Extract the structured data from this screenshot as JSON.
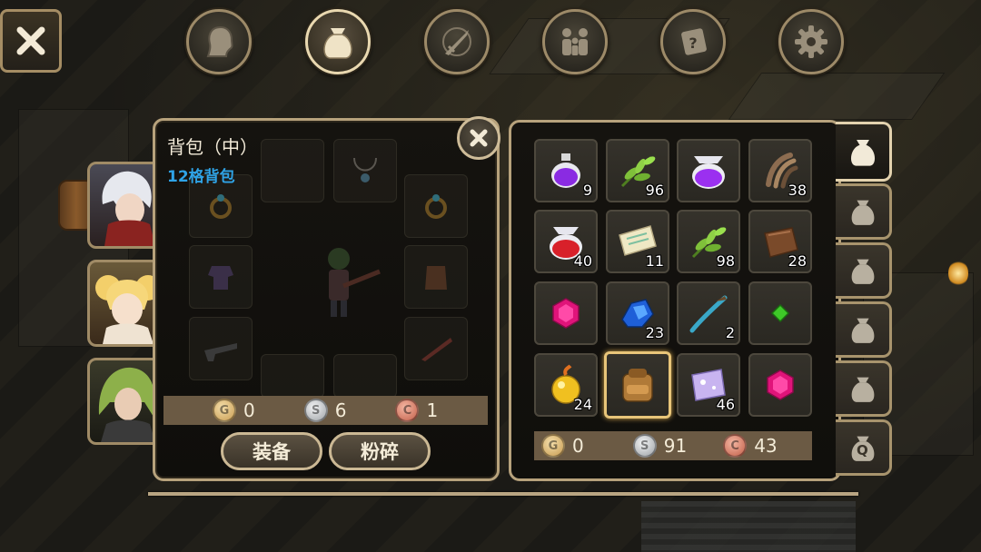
{
  "bag_panel": {
    "title": "背包（中）",
    "subtitle": "12格背包",
    "subtitle_color": "#2fa3e6",
    "currency": {
      "gold": "0",
      "silver": "6",
      "copper": "1"
    },
    "buttons": {
      "equip": "装备",
      "smash": "粉碎"
    }
  },
  "inventory": {
    "currency": {
      "gold": "0",
      "silver": "91",
      "copper": "43"
    },
    "items": [
      {
        "icon": "purple-potion-icon",
        "count": "9"
      },
      {
        "icon": "green-herb-icon",
        "count": "96"
      },
      {
        "icon": "purple-potion-large-icon",
        "count": ""
      },
      {
        "icon": "claw-icon",
        "count": "38"
      },
      {
        "icon": "red-potion-icon",
        "count": "40"
      },
      {
        "icon": "scroll-icon",
        "count": "11"
      },
      {
        "icon": "green-herb-icon",
        "count": "98"
      },
      {
        "icon": "leather-icon",
        "count": "28"
      },
      {
        "icon": "pink-gem-icon",
        "count": ""
      },
      {
        "icon": "blue-ore-icon",
        "count": "23"
      },
      {
        "icon": "dagger-icon",
        "count": "2"
      },
      {
        "icon": "small-green-gem-icon",
        "count": ""
      },
      {
        "icon": "golden-apple-icon",
        "count": "24"
      },
      {
        "icon": "backpack-icon",
        "count": ""
      },
      {
        "icon": "magic-cloth-icon",
        "count": "46"
      },
      {
        "icon": "pink-gem-icon",
        "count": ""
      }
    ]
  },
  "side_tabs": [
    "bag-1",
    "bag-2",
    "bag-3",
    "bag-4",
    "bag-5",
    "quest-bag"
  ],
  "side_tab_quest_letter": "Q",
  "top_tabs": [
    "character",
    "bag",
    "skills",
    "party",
    "quest",
    "settings"
  ],
  "colors": {
    "panel_border": "#b7a27c",
    "selected_slot": "#e8c579",
    "gold": "#e2c07a",
    "silver": "#c9cbcc",
    "copper": "#d7826a"
  }
}
